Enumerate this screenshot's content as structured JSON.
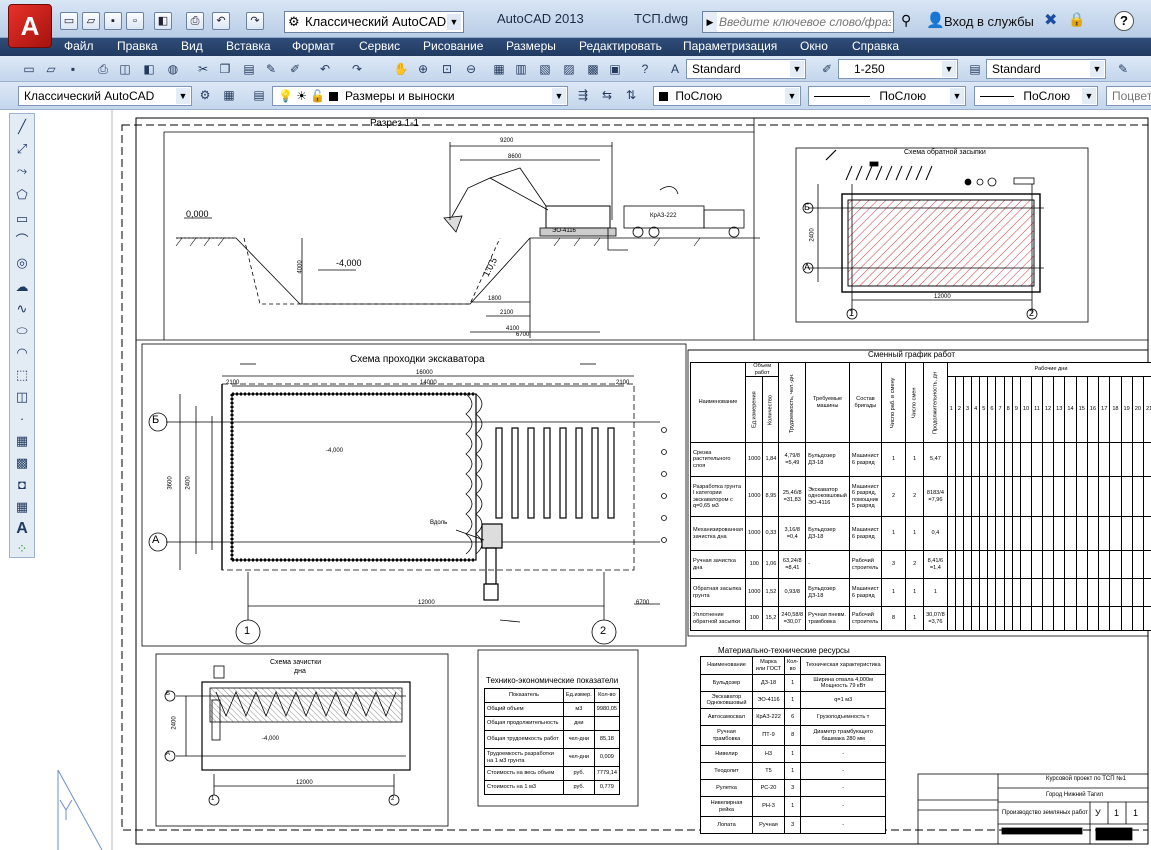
{
  "titlebar": {
    "workspace": "Классический AutoCAD",
    "app_title": "AutoCAD 2013",
    "doc_title": "ТСП.dwg",
    "search_placeholder": "Введите ключевое слово/фразу",
    "login_label": "Вход в службы",
    "help": "?"
  },
  "menu": [
    "Файл",
    "Правка",
    "Вид",
    "Вставка",
    "Формат",
    "Сервис",
    "Рисование",
    "Размеры",
    "Редактировать",
    "Параметризация",
    "Окно",
    "Справка"
  ],
  "toolbar1": {
    "text_style": "Standard",
    "dim_scale": "1-250",
    "table_style": "Standard"
  },
  "toolbar2": {
    "workspace": "Классический AutoCAD",
    "layer": "Размеры и выноски",
    "color": "ПоСлою",
    "linetype": "ПоСлою",
    "lineweight": "ПоСлою",
    "plotstyle": "Поцвет"
  },
  "drawing": {
    "section_title": "Разрез 1-1",
    "section_dims": {
      "top1": "9200",
      "top2": "8600",
      "level_top": "0,000",
      "level_bottom": "-4,000",
      "slope": "1:0,5",
      "dim_a": "1800",
      "dim_b": "2100",
      "dim_c": "4100",
      "dim_d": "6700",
      "depth": "4000",
      "crane": "КрАЗ-222",
      "excavator": "ЭО-4116"
    },
    "backfill_title": "Схема обратной засыпки",
    "backfill_axes": {
      "b": "Б",
      "a": "А",
      "one": "1",
      "two": "2",
      "width": "12000",
      "height": "2400"
    },
    "excav_title": "Схема проходки экскаватора",
    "excav_dims": {
      "top": "16000",
      "mid": "14000",
      "bottom": "12000",
      "level": "-4,000",
      "left": "2100",
      "right": "2100",
      "h1": "3600",
      "h2": "2400",
      "label": "Вдоль",
      "far": "6700"
    },
    "excav_axes": {
      "b": "Б",
      "a": "А",
      "one": "1",
      "two": "2"
    },
    "cleanup_title": "Схема зачистки",
    "cleanup_sub": "дна",
    "cleanup_axes": {
      "b": "Б",
      "a": "А",
      "one": "1",
      "two": "2",
      "width": "12000",
      "height": "2400",
      "label": "-4,000"
    },
    "tep": {
      "title": "Технико-экономические показатели",
      "headers": [
        "Показатель",
        "Ед.измер.",
        "Кол-во"
      ],
      "rows": [
        [
          "Общий объем",
          "м3",
          "9980,05"
        ],
        [
          "Общая продолжительность",
          "дни",
          ""
        ],
        [
          "Общая трудоемкость работ",
          "чел-дни",
          "85,18"
        ],
        [
          "Трудоемкость разработки на 1 м3 грунта",
          "чел-дни",
          "0,009"
        ],
        [
          "Стоимость на весь объем",
          "руб.",
          "7779,14"
        ],
        [
          "Стоимость на 1 м3",
          "руб.",
          "0,779"
        ]
      ]
    },
    "schedule": {
      "title": "Сменный график работ",
      "h_name": "Наименование",
      "h_volume": "Объем работ",
      "h_unit": "Ед.измерения",
      "h_qty": "Количество",
      "h_labor": "Трудоемкость, чел.-дн.",
      "h_machines": "Требуемые машины",
      "h_brigade": "Состав бригады",
      "h_workers": "Число раб. в смену",
      "h_shifts": "Число смен",
      "h_duration": "Продолжительность, дн",
      "h_days": "Рабочие дни",
      "days": [
        "1",
        "2",
        "3",
        "4",
        "5",
        "6",
        "7",
        "8",
        "9",
        "10",
        "11",
        "12",
        "13",
        "14",
        "15",
        "16",
        "17",
        "18",
        "19",
        "20",
        "21"
      ],
      "rows": [
        [
          "Срезка растительного слоя",
          "1000",
          "1,84",
          "4,79/8 =5,49",
          "Бульдозер ДЗ-18",
          "Машинист 6 разряд",
          "1",
          "1",
          "5,47"
        ],
        [
          "Разработка грунта I категории экскаватором с q=0,65 м3",
          "1000",
          "8,95",
          "25,4б/8 =31,83",
          "Экскаватор одноковшовый ЭО-4116",
          "Машинист 6 разряд, помощник 5 разряд",
          "2",
          "2",
          "8183/4 =7,96"
        ],
        [
          "Механизированная зачистка дна",
          "1000",
          "0,33",
          "3,16/8 =0,4",
          "Бульдозер ДЗ-18",
          "Машинист 6 разряд",
          "1",
          "1",
          "0,4"
        ],
        [
          "Ручная зачистка дна",
          "100",
          "1,06",
          "63,24/8 =8,41",
          "-",
          "Рабочий строитель",
          "3",
          "2",
          "8,41/6 =1,4"
        ],
        [
          "Обратная засыпка грунта",
          "1000",
          "1,52",
          "0,93/8",
          "Бульдозер ДЗ-18",
          "Машинист 6 разряд",
          "1",
          "1",
          "1"
        ],
        [
          "Уплотнение обратной засыпки",
          "100",
          "15,2",
          "240,58/8 =30,07",
          "Ручная пневм. трамбовка",
          "Рабочий строитель",
          "8",
          "1",
          "30,07/8 =3,76"
        ]
      ]
    },
    "resources": {
      "title": "Материально-технические ресурсы",
      "headers": [
        "Наименование",
        "Марка или ГОСТ",
        "Кол-во",
        "Техническая характеристика"
      ],
      "rows": [
        [
          "Бульдозер",
          "ДЗ-18",
          "1",
          "Ширина отвала 4,000м Мощность 79 кВт"
        ],
        [
          "Экскаватор Одноковшовый",
          "ЭО-4116",
          "1",
          "q=1 м3"
        ],
        [
          "Автосамосвал",
          "КрАЗ-222",
          "6",
          "Грузоподъемность т"
        ],
        [
          "Ручная трамбовка",
          "ПТ-9",
          "8",
          "Диаметр трамбующего башмака 280 мм"
        ],
        [
          "Нивелир",
          "Н3",
          "1",
          "-"
        ],
        [
          "Теодолит",
          "Т5",
          "1",
          "-"
        ],
        [
          "Рулетка",
          "РС-20",
          "3",
          "-"
        ],
        [
          "Нивелирная рейка",
          "РН-3",
          "1",
          "-"
        ],
        [
          "Лопата",
          "Ручная",
          "3",
          "-"
        ]
      ]
    },
    "stamp": {
      "project": "Курсовой проект по ТСП №1",
      "city": "Город Нижний Тагил",
      "work": "Производство земляных работ",
      "stage": "У",
      "sheet": "1",
      "sheets": "1"
    }
  }
}
